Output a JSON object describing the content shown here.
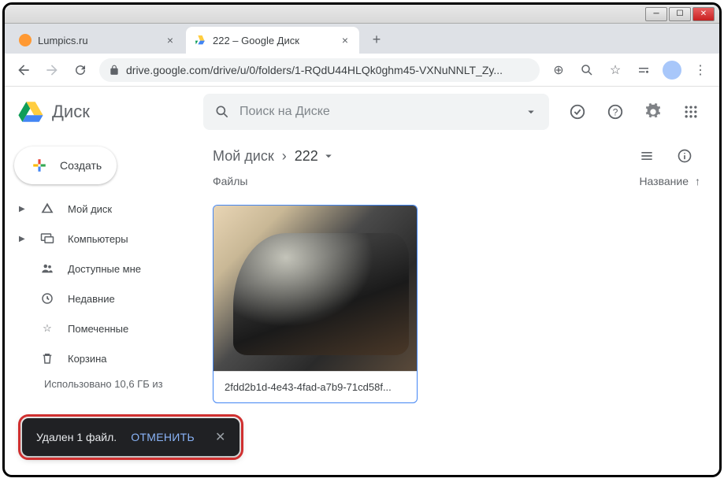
{
  "window": {
    "tabs": [
      {
        "title": "Lumpics.ru",
        "favicon_color": "#ff9933"
      },
      {
        "title": "222 – Google Диск",
        "active": true
      }
    ],
    "url": "drive.google.com/drive/u/0/folders/1-RQdU44HLQk0ghm45-VXNuNNLT_Zy..."
  },
  "header": {
    "app_name": "Диск",
    "search_placeholder": "Поиск на Диске"
  },
  "sidebar": {
    "create_label": "Создать",
    "items": [
      {
        "label": "Мой диск",
        "icon": "drive-icon",
        "expandable": true
      },
      {
        "label": "Компьютеры",
        "icon": "computers-icon",
        "expandable": true
      },
      {
        "label": "Доступные мне",
        "icon": "shared-icon",
        "expandable": false
      },
      {
        "label": "Недавние",
        "icon": "recent-icon",
        "expandable": false
      },
      {
        "label": "Помеченные",
        "icon": "starred-icon",
        "expandable": false
      },
      {
        "label": "Корзина",
        "icon": "trash-icon",
        "expandable": false
      }
    ],
    "storage_text": "Использовано 10,6 ГБ из"
  },
  "breadcrumb": {
    "root": "Мой диск",
    "current": "222"
  },
  "content": {
    "section_label": "Файлы",
    "sort_label": "Название",
    "files": [
      {
        "name": "2fdd2b1d-4e43-4fad-a7b9-71cd58f..."
      }
    ]
  },
  "toast": {
    "message": "Удален 1 файл.",
    "action": "ОТМЕНИТЬ"
  }
}
